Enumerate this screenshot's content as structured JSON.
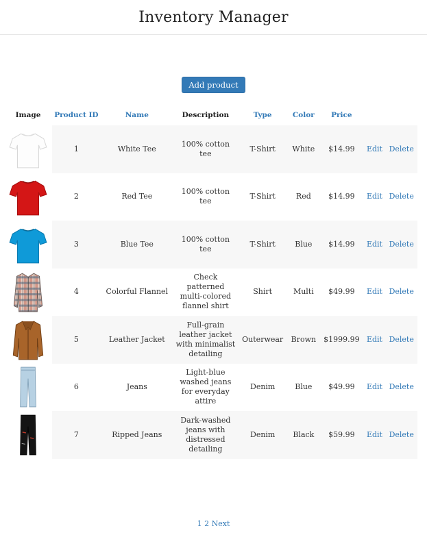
{
  "header": {
    "title": "Inventory Manager"
  },
  "actions": {
    "add_label": "Add product"
  },
  "table": {
    "columns": [
      "Image",
      "Product ID",
      "Name",
      "Description",
      "Type",
      "Color",
      "Price"
    ],
    "edit_label": "Edit",
    "delete_label": "Delete",
    "rows": [
      {
        "id": "1",
        "name": "White Tee",
        "description": "100% cotton tee",
        "type": "T-Shirt",
        "color": "White",
        "price": "$14.99",
        "image": "white-tshirt-image"
      },
      {
        "id": "2",
        "name": "Red Tee",
        "description": "100% cotton tee",
        "type": "T-Shirt",
        "color": "Red",
        "price": "$14.99",
        "image": "red-tshirt-image"
      },
      {
        "id": "3",
        "name": "Blue Tee",
        "description": "100% cotton tee",
        "type": "T-Shirt",
        "color": "Blue",
        "price": "$14.99",
        "image": "blue-tshirt-image"
      },
      {
        "id": "4",
        "name": "Colorful Flannel",
        "description": "Check patterned multi-colored flannel shirt",
        "type": "Shirt",
        "color": "Multi",
        "price": "$49.99",
        "image": "flannel-shirt-image"
      },
      {
        "id": "5",
        "name": "Leather Jacket",
        "description": "Full-grain leather jacket with minimalist detailing",
        "type": "Outerwear",
        "color": "Brown",
        "price": "$1999.99",
        "image": "leather-jacket-image"
      },
      {
        "id": "6",
        "name": "Jeans",
        "description": "Light-blue washed jeans for everyday attire",
        "type": "Denim",
        "color": "Blue",
        "price": "$49.99",
        "image": "light-jeans-image"
      },
      {
        "id": "7",
        "name": "Ripped Jeans",
        "description": "Dark-washed jeans with distressed detailing",
        "type": "Denim",
        "color": "Black",
        "price": "$59.99",
        "image": "ripped-jeans-image"
      }
    ]
  },
  "pagination": {
    "pages": [
      "1",
      "2"
    ],
    "next_label": "Next"
  },
  "colors": {
    "accent": "#337ab7",
    "row_stripe": "#f7f7f7"
  }
}
